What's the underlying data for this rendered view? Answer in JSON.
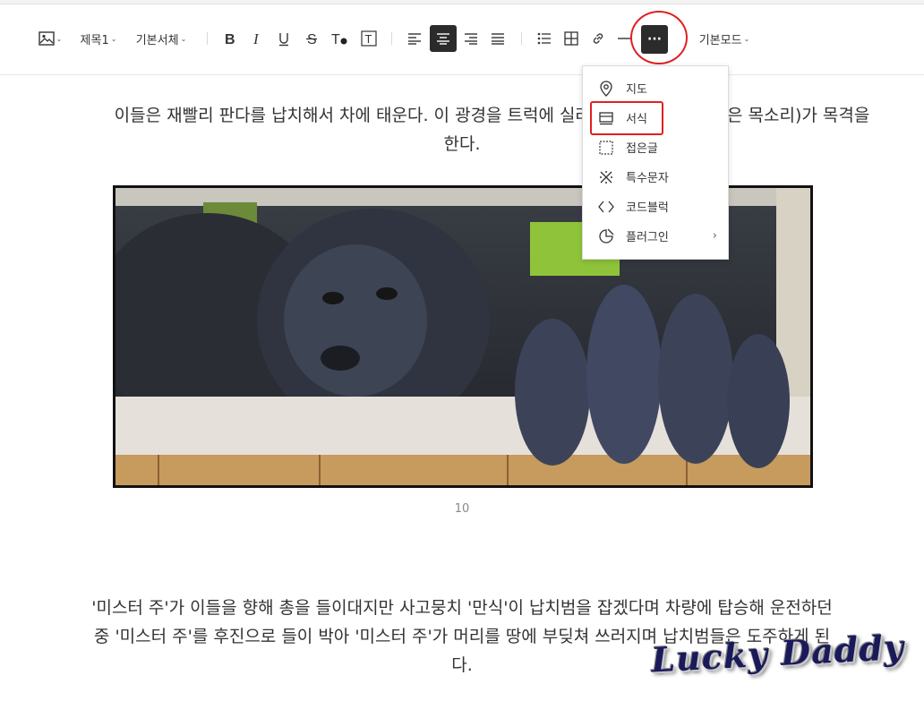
{
  "toolbar": {
    "heading_label": "제목1",
    "font_label": "기본서체",
    "mode_label": "기본모드",
    "more_glyph": "···"
  },
  "dropdown": {
    "items": [
      {
        "label": "지도",
        "icon": "map-pin-icon"
      },
      {
        "label": "서식",
        "icon": "template-icon"
      },
      {
        "label": "접은글",
        "icon": "fold-box-icon"
      },
      {
        "label": "특수문자",
        "icon": "special-char-icon"
      },
      {
        "label": "코드블럭",
        "icon": "code-icon"
      },
      {
        "label": "플러그인",
        "icon": "plugin-icon"
      }
    ],
    "submenu_arrow": "›"
  },
  "content": {
    "paragraph1_line1_left": "이들은 재빨리 판다를 납치해서 차에 태운다. 이 광경을 트럭에 실려",
    "paragraph1_line1_right": "은 목소리)가 목격을",
    "paragraph1_line2": "한다.",
    "image_caption": "10",
    "paragraph2_line1": "'미스터 주'가 이들을 향해 총을 들이대지만 사고뭉치 '만식'이 납치범을 잡겠다며 차량에 탑승해 운전하던",
    "paragraph2_line2": "중 '미스터 주'를 후진으로 들이 박아 '미스터 주'가 머리를 땅에 부딪쳐 쓰러지며 납치범들은 도주하게 된",
    "paragraph2_line3": "다."
  },
  "watermark": {
    "text": "Lucky Daddy"
  },
  "colors": {
    "annotation_red": "#e02020",
    "active_button": "#2b2b2b"
  }
}
